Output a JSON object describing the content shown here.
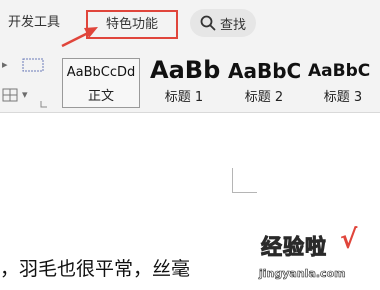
{
  "ribbon": {
    "tabs": [
      {
        "label": "开发工具"
      },
      {
        "label": "特色功能",
        "highlighted": true
      }
    ],
    "search_label": "查找",
    "highlight_color": "#e0453b"
  },
  "styles": [
    {
      "preview": "AaBbCcDd",
      "name": "正文",
      "selected": true
    },
    {
      "preview": "AaBb",
      "name": "标题 1"
    },
    {
      "preview": "AaBbC",
      "name": "标题 2"
    },
    {
      "preview": "AaBbC",
      "name": "标题 3"
    }
  ],
  "document": {
    "text": "，羽毛也很平常，丝毫"
  },
  "watermark": {
    "brand": "经验啦",
    "check": "√",
    "url": "jingyanla.com"
  }
}
